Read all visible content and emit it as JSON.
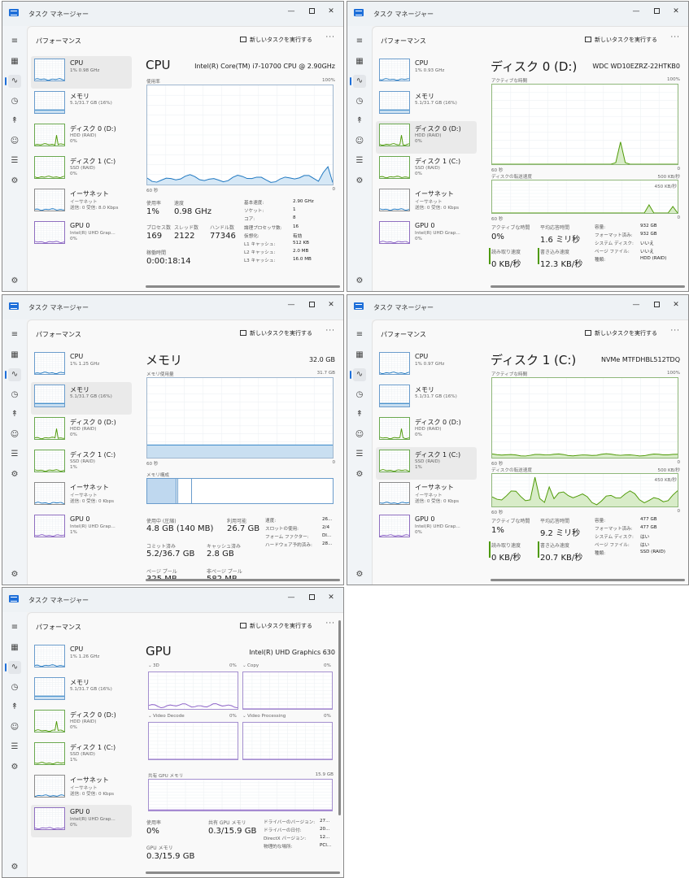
{
  "windows": [
    {
      "id": "cpu",
      "app_title": "タスク マネージャー",
      "section_title": "パフォーマンス",
      "new_task_label": "新しいタスクを実行する",
      "sidebar": [
        {
          "name": "CPU",
          "sub": "1% 0.98 GHz",
          "sub2": "",
          "selected": true
        },
        {
          "name": "メモリ",
          "sub": "5.1/31.7 GB (16%)",
          "sub2": "",
          "selected": false
        },
        {
          "name": "ディスク 0 (D:)",
          "sub": "HDD (RAID)",
          "sub2": "0%",
          "selected": false
        },
        {
          "name": "ディスク 1 (C:)",
          "sub": "SSD (RAID)",
          "sub2": "0%",
          "selected": false
        },
        {
          "name": "イーサネット",
          "sub": "イーサネット",
          "sub2": "送信: 0 受信: 8.0 Kbps",
          "selected": false
        },
        {
          "name": "GPU 0",
          "sub": "Intel(R) UHD Grap...",
          "sub2": "0%",
          "selected": false
        }
      ],
      "main": {
        "title": "CPU",
        "model": "Intel(R) Core(TM) i7-10700 CPU @ 2.90GHz",
        "graph_label": "使用率",
        "graph_max": "100%",
        "graph_time": "60 秒",
        "graph_min": "0",
        "stats": [
          {
            "label": "使用率",
            "value": "1%"
          },
          {
            "label": "速度",
            "value": "0.98 GHz"
          },
          {
            "label": "プロセス数",
            "value": "169"
          },
          {
            "label": "スレッド数",
            "value": "2122"
          },
          {
            "label": "ハンドル数",
            "value": "77346"
          },
          {
            "label": "稼働時間",
            "value": "0:00:18:14"
          }
        ],
        "kv": [
          {
            "k": "基本速度:",
            "v": "2.90 GHz"
          },
          {
            "k": "ソケット:",
            "v": "1"
          },
          {
            "k": "コア:",
            "v": "8"
          },
          {
            "k": "論理プロセッサ数:",
            "v": "16"
          },
          {
            "k": "仮想化:",
            "v": "有効"
          },
          {
            "k": "L1 キャッシュ:",
            "v": "512 KB"
          },
          {
            "k": "L2 キャッシュ:",
            "v": "2.0 MB"
          },
          {
            "k": "L3 キャッシュ:",
            "v": "16.0 MB"
          }
        ]
      }
    },
    {
      "id": "disk0",
      "app_title": "タスク マネージャー",
      "section_title": "パフォーマンス",
      "new_task_label": "新しいタスクを実行する",
      "sidebar": [
        {
          "name": "CPU",
          "sub": "1% 0.93 GHz",
          "sub2": "",
          "selected": false
        },
        {
          "name": "メモリ",
          "sub": "5.1/31.7 GB (16%)",
          "sub2": "",
          "selected": false
        },
        {
          "name": "ディスク 0 (D:)",
          "sub": "HDD (RAID)",
          "sub2": "0%",
          "selected": true
        },
        {
          "name": "ディスク 1 (C:)",
          "sub": "SSD (RAID)",
          "sub2": "0%",
          "selected": false
        },
        {
          "name": "イーサネット",
          "sub": "イーサネット",
          "sub2": "送信: 0 受信: 0 Kbps",
          "selected": false
        },
        {
          "name": "GPU 0",
          "sub": "Intel(R) UHD Grap...",
          "sub2": "0%",
          "selected": false
        }
      ],
      "main": {
        "title": "ディスク 0 (D:)",
        "model": "WDC WD10EZRZ-22HTKB0",
        "graph1_label": "アクティブな時間",
        "graph1_max": "100%",
        "graph_time": "60 秒",
        "graph_min": "0",
        "graph2_label": "ディスクの転送速度",
        "graph2_max": "500 KB/秒",
        "graph2_sub": "450 KB/秒",
        "stats": [
          {
            "label": "アクティブな時間",
            "value": "0%"
          },
          {
            "label": "平均応答時間",
            "value": "1.6 ミリ秒"
          },
          {
            "label": "読み取り速度",
            "value": "0 KB/秒"
          },
          {
            "label": "書き込み速度",
            "value": "12.3 KB/秒"
          }
        ],
        "kv": [
          {
            "k": "容量:",
            "v": "932 GB"
          },
          {
            "k": "フォーマット済み:",
            "v": "932 GB"
          },
          {
            "k": "システム ディスク:",
            "v": "いいえ"
          },
          {
            "k": "ページ ファイル:",
            "v": "いいえ"
          },
          {
            "k": "種類:",
            "v": "HDD (RAID)"
          }
        ]
      }
    },
    {
      "id": "memory",
      "app_title": "タスク マネージャー",
      "section_title": "パフォーマンス",
      "new_task_label": "新しいタスクを実行する",
      "sidebar": [
        {
          "name": "CPU",
          "sub": "1% 1.25 GHz",
          "sub2": "",
          "selected": false
        },
        {
          "name": "メモリ",
          "sub": "5.1/31.7 GB (16%)",
          "sub2": "",
          "selected": true
        },
        {
          "name": "ディスク 0 (D:)",
          "sub": "HDD (RAID)",
          "sub2": "0%",
          "selected": false
        },
        {
          "name": "ディスク 1 (C:)",
          "sub": "SSD (RAID)",
          "sub2": "1%",
          "selected": false
        },
        {
          "name": "イーサネット",
          "sub": "イーサネット",
          "sub2": "送信: 0 受信: 0 Kbps",
          "selected": false
        },
        {
          "name": "GPU 0",
          "sub": "Intel(R) UHD Grap...",
          "sub2": "1%",
          "selected": false
        }
      ],
      "main": {
        "title": "メモリ",
        "model": "32.0 GB",
        "graph_label": "メモリ使用量",
        "graph_max": "31.7 GB",
        "graph_time": "60 秒",
        "graph_min": "0",
        "composition_label": "メモリ構成",
        "stats": [
          {
            "label": "使用中 (圧縮)",
            "value": "4.8 GB (140 MB)"
          },
          {
            "label": "利用可能",
            "value": "26.7 GB"
          },
          {
            "label": "コミット済み",
            "value": "5.2/36.7 GB"
          },
          {
            "label": "キャッシュ済み",
            "value": "2.8 GB"
          },
          {
            "label": "ページ プール",
            "value": "325 MB"
          },
          {
            "label": "非ページ プール",
            "value": "582 MB"
          }
        ],
        "kv": [
          {
            "k": "速度:",
            "v": "26..."
          },
          {
            "k": "スロットの使用:",
            "v": "2/4"
          },
          {
            "k": "フォーム ファクター:",
            "v": "DI..."
          },
          {
            "k": "ハードウェア予約済み:",
            "v": "28..."
          }
        ]
      }
    },
    {
      "id": "disk1",
      "app_title": "タスク マネージャー",
      "section_title": "パフォーマンス",
      "new_task_label": "新しいタスクを実行する",
      "sidebar": [
        {
          "name": "CPU",
          "sub": "1% 0.97 GHz",
          "sub2": "",
          "selected": false
        },
        {
          "name": "メモリ",
          "sub": "5.1/31.7 GB (16%)",
          "sub2": "",
          "selected": false
        },
        {
          "name": "ディスク 0 (D:)",
          "sub": "HDD (RAID)",
          "sub2": "0%",
          "selected": false
        },
        {
          "name": "ディスク 1 (C:)",
          "sub": "SSD (RAID)",
          "sub2": "1%",
          "selected": true
        },
        {
          "name": "イーサネット",
          "sub": "イーサネット",
          "sub2": "送信: 0 受信: 0 Kbps",
          "selected": false
        },
        {
          "name": "GPU 0",
          "sub": "Intel(R) UHD Grap...",
          "sub2": "0%",
          "selected": false
        }
      ],
      "main": {
        "title": "ディスク 1 (C:)",
        "model": "NVMe MTFDHBL512TDQ",
        "graph1_label": "アクティブな時間",
        "graph1_max": "100%",
        "graph_time": "60 秒",
        "graph_min": "0",
        "graph2_label": "ディスクの転送速度",
        "graph2_max": "500 KB/秒",
        "graph2_sub": "450 KB/秒",
        "stats": [
          {
            "label": "アクティブな時間",
            "value": "1%"
          },
          {
            "label": "平均応答時間",
            "value": "9.2 ミリ秒"
          },
          {
            "label": "読み取り速度",
            "value": "0 KB/秒"
          },
          {
            "label": "書き込み速度",
            "value": "20.7 KB/秒"
          }
        ],
        "kv": [
          {
            "k": "容量:",
            "v": "477 GB"
          },
          {
            "k": "フォーマット済み:",
            "v": "477 GB"
          },
          {
            "k": "システム ディスク:",
            "v": "はい"
          },
          {
            "k": "ページ ファイル:",
            "v": "はい"
          },
          {
            "k": "種類:",
            "v": "SSD (RAID)"
          }
        ]
      }
    },
    {
      "id": "gpu",
      "app_title": "タスク マネージャー",
      "section_title": "パフォーマンス",
      "new_task_label": "新しいタスクを実行する",
      "sidebar": [
        {
          "name": "CPU",
          "sub": "1% 1.26 GHz",
          "sub2": "",
          "selected": false
        },
        {
          "name": "メモリ",
          "sub": "5.1/31.7 GB (16%)",
          "sub2": "",
          "selected": false
        },
        {
          "name": "ディスク 0 (D:)",
          "sub": "HDD (RAID)",
          "sub2": "0%",
          "selected": false
        },
        {
          "name": "ディスク 1 (C:)",
          "sub": "SSD (RAID)",
          "sub2": "1%",
          "selected": false
        },
        {
          "name": "イーサネット",
          "sub": "イーサネット",
          "sub2": "送信: 0 受信: 0 Kbps",
          "selected": false
        },
        {
          "name": "GPU 0",
          "sub": "Intel(R) UHD Grap...",
          "sub2": "0%",
          "selected": true
        }
      ],
      "main": {
        "title": "GPU",
        "model": "Intel(R) UHD Graphics 630",
        "engines": [
          {
            "label": "3D",
            "pct": "0%"
          },
          {
            "label": "Copy",
            "pct": "0%"
          },
          {
            "label": "Video Decode",
            "pct": "0%"
          },
          {
            "label": "Video Processing",
            "pct": "0%"
          }
        ],
        "shared_label": "共有 GPU メモリ",
        "shared_max": "15.9 GB",
        "stats": [
          {
            "label": "使用率",
            "value": "0%"
          },
          {
            "label": "共有 GPU メモリ",
            "value": "0.3/15.9 GB"
          },
          {
            "label": "GPU メモリ",
            "value": "0.3/15.9 GB"
          }
        ],
        "kv": [
          {
            "k": "ドライバーのバージョン:",
            "v": "27..."
          },
          {
            "k": "ドライバーの日付:",
            "v": "20..."
          },
          {
            "k": "DirectX バージョン:",
            "v": "12..."
          },
          {
            "k": "物理的な場所:",
            "v": "PCI..."
          }
        ]
      }
    }
  ],
  "colors": {
    "cpu_line": "#1f78c1",
    "cpu_fill": "#d6e8f6",
    "disk_line": "#4e9a06",
    "disk_fill": "#d8ecc8",
    "mem_fill": "#c9dff1",
    "gpu_line": "#8a5fc7",
    "accent": "#1e6fd9"
  },
  "nav_icons": [
    "hamburger-icon",
    "processes-icon",
    "performance-icon",
    "app-history-icon",
    "startup-icon",
    "users-icon",
    "details-icon",
    "services-icon",
    "settings-icon"
  ]
}
